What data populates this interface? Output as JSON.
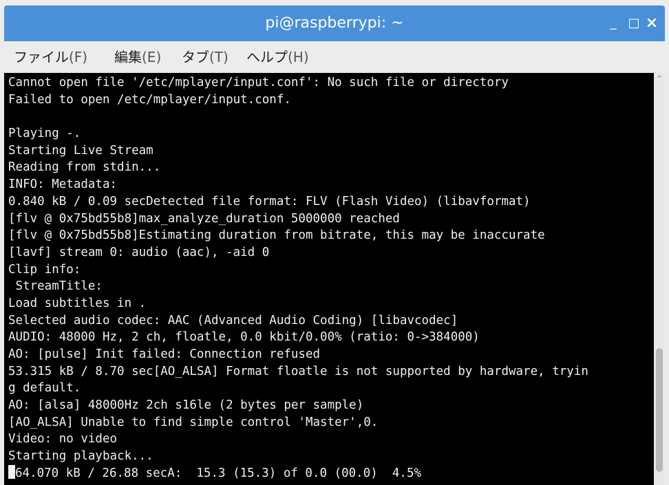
{
  "window": {
    "title": "pi@raspberrypi: ~",
    "controls": {
      "minimize": "_",
      "maximize": "□",
      "close": "×"
    }
  },
  "menu": {
    "items": [
      {
        "label": "ファイル",
        "accel": "(F)"
      },
      {
        "label": "編集",
        "accel": "(E)"
      },
      {
        "label": "タブ",
        "accel": "(T)"
      },
      {
        "label": "ヘルプ",
        "accel": "(H)"
      }
    ]
  },
  "terminal": {
    "lines": [
      "Cannot open file '/etc/mplayer/input.conf': No such file or directory",
      "Failed to open /etc/mplayer/input.conf.",
      "",
      "Playing -.",
      "Starting Live Stream",
      "Reading from stdin...",
      "INFO: Metadata:",
      "0.840 kB / 0.09 secDetected file format: FLV (Flash Video) (libavformat)",
      "[flv @ 0x75bd55b8]max_analyze_duration 5000000 reached",
      "[flv @ 0x75bd55b8]Estimating duration from bitrate, this may be inaccurate",
      "[lavf] stream 0: audio (aac), -aid 0",
      "Clip info:",
      " StreamTitle:",
      "Load subtitles in .",
      "Selected audio codec: AAC (Advanced Audio Coding) [libavcodec]",
      "AUDIO: 48000 Hz, 2 ch, floatle, 0.0 kbit/0.00% (ratio: 0->384000)",
      "AO: [pulse] Init failed: Connection refused",
      "53.315 kB / 8.70 sec[AO_ALSA] Format floatle is not supported by hardware, tryin",
      "g default.",
      "AO: [alsa] 48000Hz 2ch s16le (2 bytes per sample)",
      "[AO_ALSA] Unable to find simple control 'Master',0.",
      "Video: no video",
      "Starting playback...",
      "64.070 kB / 26.88 secA:  15.3 (15.3) of 0.0 (00.0)  4.5%"
    ]
  },
  "scrollbar": {
    "up_arrow": "^"
  },
  "colors": {
    "titlebar": "#4a90d9",
    "terminal_bg": "#000000",
    "terminal_fg": "#f0f0f0",
    "menubar_bg": "#ececec"
  }
}
